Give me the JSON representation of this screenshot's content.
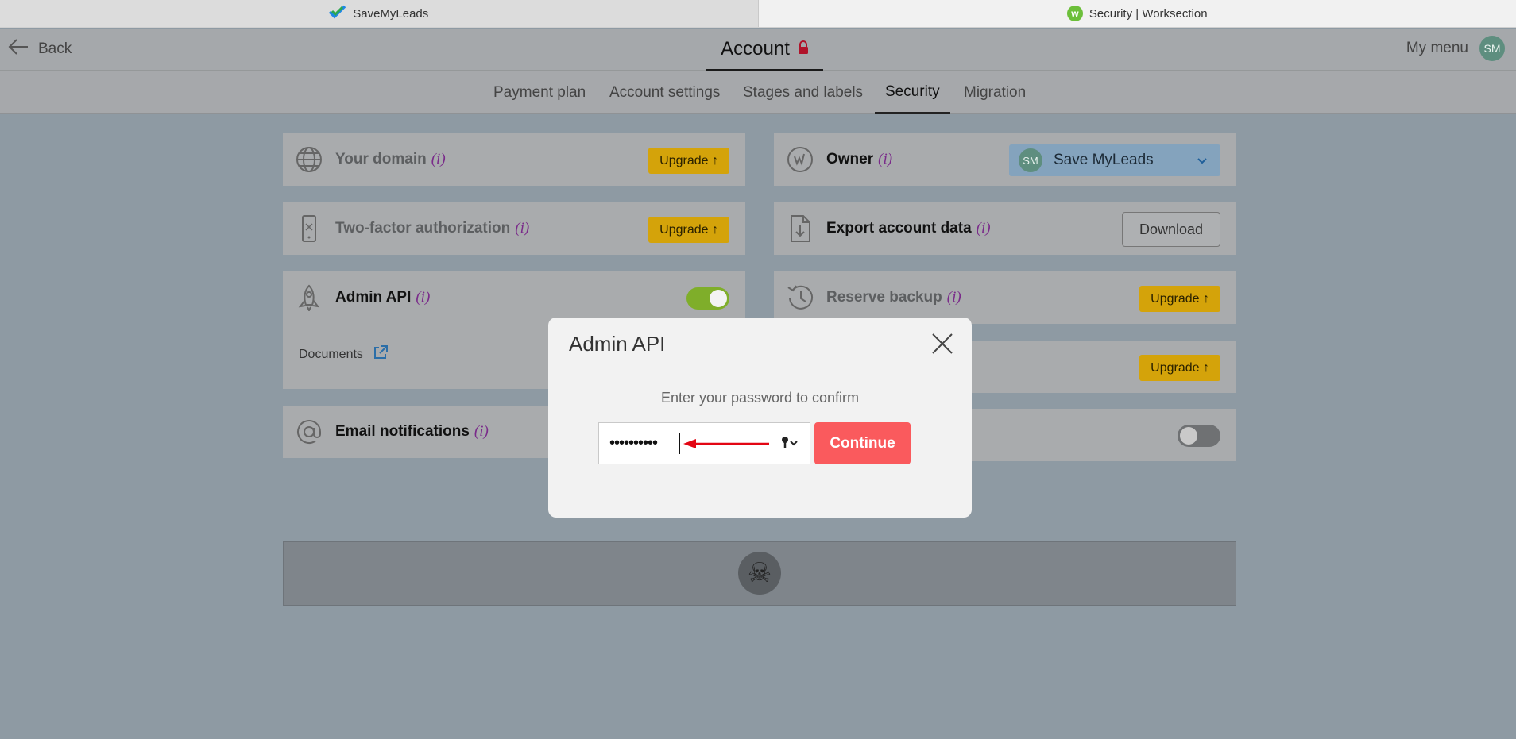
{
  "browser": {
    "tabs": [
      {
        "label": "SaveMyLeads"
      },
      {
        "label": "Security | Worksection"
      }
    ],
    "ws_favicon": "w"
  },
  "header": {
    "back_label": "Back",
    "title": "Account",
    "menu_label": "My menu",
    "avatar_initials": "SM"
  },
  "subnav": {
    "items": [
      "Payment plan",
      "Account settings",
      "Stages and labels",
      "Security",
      "Migration"
    ],
    "active": "Security"
  },
  "left_cards": {
    "domain": {
      "title": "Your domain",
      "info": "(i)",
      "upgrade": "Upgrade ↑"
    },
    "twofa": {
      "title": "Two-factor authorization",
      "info": "(i)",
      "upgrade": "Upgrade ↑"
    },
    "admin_api": {
      "title": "Admin API",
      "info": "(i)",
      "enabled": true,
      "documents_label": "Documents"
    },
    "email": {
      "title": "Email notifications",
      "info": "(i)"
    }
  },
  "right_cards": {
    "owner": {
      "title": "Owner",
      "info": "(i)",
      "selected_initials": "SM",
      "selected_name": "Save MyLeads"
    },
    "export": {
      "title": "Export account data",
      "info": "(i)",
      "button": "Download"
    },
    "backup": {
      "title": "Reserve backup",
      "info": "(i)",
      "upgrade": "Upgrade ↑"
    },
    "hidden_row": {
      "upgrade": "Upgrade ↑"
    },
    "toggle_row": {
      "enabled": false
    }
  },
  "danger_zone": {
    "icon": "☠"
  },
  "modal": {
    "title": "Admin API",
    "label": "Enter your password to confirm",
    "password_mask": "••••••••••",
    "continue_label": "Continue"
  },
  "colors": {
    "accent_green": "#7fae2a",
    "upgrade_yellow": "#d4a30a",
    "continue_red": "#fa5a5d",
    "arrow_red": "#e30613"
  }
}
